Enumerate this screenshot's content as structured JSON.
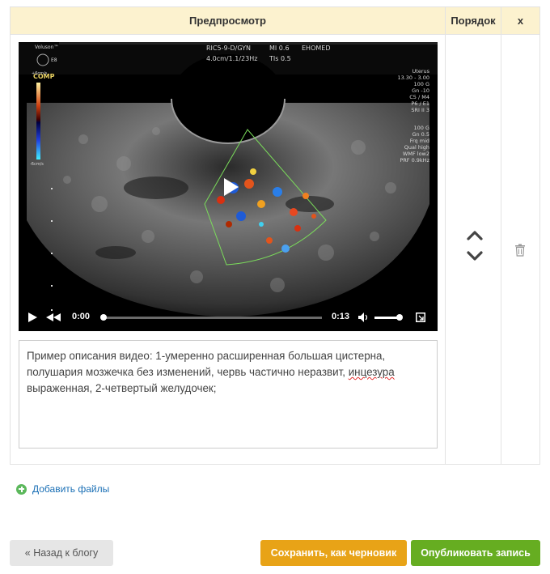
{
  "table": {
    "col_preview": "Предпросмотр",
    "col_order": "Порядок",
    "col_delete": "x"
  },
  "video": {
    "overlay": {
      "brand": "Voluson™",
      "brand_sub": "E8",
      "probe": "RIC5-9-D/GYN",
      "depth": "4.0cm/1.1/23Hz",
      "mi": "MI 0.6",
      "tis": "TIs 0.5",
      "institution": "EHOMED",
      "mode": "COMP",
      "scale_top": "+6cm/s",
      "scale_bottom": "-6cm/s",
      "params_right": "Uterus\n13.30 - 3.00\n100 G\nGn -10\nC5 / M4\nP6 / E1\nSRI II 3",
      "params_color": "100 G\nGn 0.5\nFrq mid\nQual high\nWMF low2\nPRF 0.9kHz"
    },
    "time_current": "0:00",
    "time_total": "0:13",
    "progress": 0.0,
    "volume": 0.85
  },
  "description": {
    "before_error": "Пример описания видео: 1-умеренно расширенная большая цистерна, полушария мозжечка без изменений, червь частично неразвит, ",
    "misspelled": "инцезура",
    "after_error": " выраженная, 2-четвертый желудочек;"
  },
  "actions": {
    "add_files": "Добавить файлы",
    "back": "« Назад к блогу",
    "save_draft": "Сохранить, как черновик",
    "publish": "Опубликовать запись"
  },
  "icons": {
    "move_up": "chevron-up-icon",
    "move_down": "chevron-down-icon",
    "delete": "trash-icon",
    "add": "plus-circle-icon",
    "play": "play-icon",
    "rewind": "rewind-icon",
    "volume": "volume-icon",
    "fullscreen": "fullscreen-icon"
  },
  "colors": {
    "header_bg": "#fcf2cf",
    "draft_button": "#e8a317",
    "publish_button": "#66ad21",
    "link": "#1a6fb5"
  }
}
